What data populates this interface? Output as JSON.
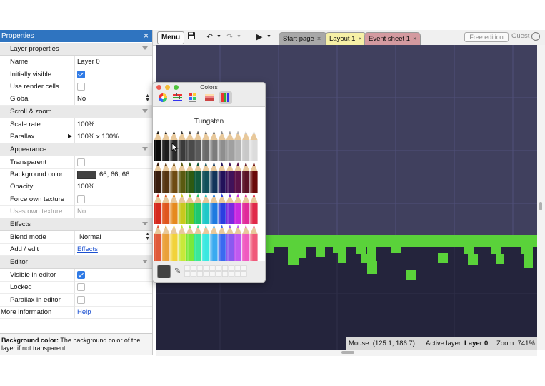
{
  "properties": {
    "title": "Properties",
    "sections": {
      "layer": "Layer properties",
      "scroll": "Scroll & zoom",
      "appearance": "Appearance",
      "effects": "Effects",
      "editor": "Editor"
    },
    "rows": {
      "name": {
        "key": "Name",
        "value": "Layer 0"
      },
      "initially_visible": {
        "key": "Initially visible",
        "checked": true
      },
      "use_render_cells": {
        "key": "Use render cells",
        "checked": false
      },
      "global": {
        "key": "Global",
        "value": "No"
      },
      "scale_rate": {
        "key": "Scale rate",
        "value": "100%"
      },
      "parallax": {
        "key": "Parallax",
        "value": "100% x 100%"
      },
      "transparent": {
        "key": "Transparent",
        "checked": false
      },
      "background_color": {
        "key": "Background color",
        "value": "66, 66, 66",
        "swatch": "#424242"
      },
      "opacity": {
        "key": "Opacity",
        "value": "100%"
      },
      "force_own_texture": {
        "key": "Force own texture",
        "checked": false
      },
      "uses_own_texture": {
        "key": "Uses own texture",
        "value": "No"
      },
      "blend_mode": {
        "key": "Blend mode",
        "value": "Normal"
      },
      "add_edit": {
        "key": "Add / edit",
        "value": "Effects"
      },
      "visible_in_editor": {
        "key": "Visible in editor",
        "checked": true
      },
      "locked": {
        "key": "Locked",
        "checked": false
      },
      "parallax_in_editor": {
        "key": "Parallax in editor",
        "checked": false
      },
      "more_info": {
        "key": "More information",
        "value": "Help"
      }
    },
    "description": {
      "bold": "Background color:",
      "text": " The background color of the layer if not transparent."
    }
  },
  "toolbar": {
    "menu_label": "Menu",
    "tabs": [
      {
        "label": "Start page",
        "color": "#a8a8a8"
      },
      {
        "label": "Layout 1",
        "color": "#f6f0a6"
      },
      {
        "label": "Event sheet 1",
        "color": "#d49aa0"
      }
    ],
    "tab_close": "×",
    "free_edition": "Free edition",
    "guest": "Guest"
  },
  "status": {
    "mouse": "Mouse: (125.1, 186.7)",
    "active_layer_label": "Active layer:",
    "active_layer_value": "Layer 0",
    "zoom": "Zoom: 741%"
  },
  "colors_window": {
    "title": "Colors",
    "selected_name": "Tungsten",
    "current_color": "#424242"
  },
  "colors": {
    "canvas_bg": "#40405e",
    "ground": "#5ad23a",
    "ground_dark": "#24243c",
    "accent": "#2f74c0"
  }
}
